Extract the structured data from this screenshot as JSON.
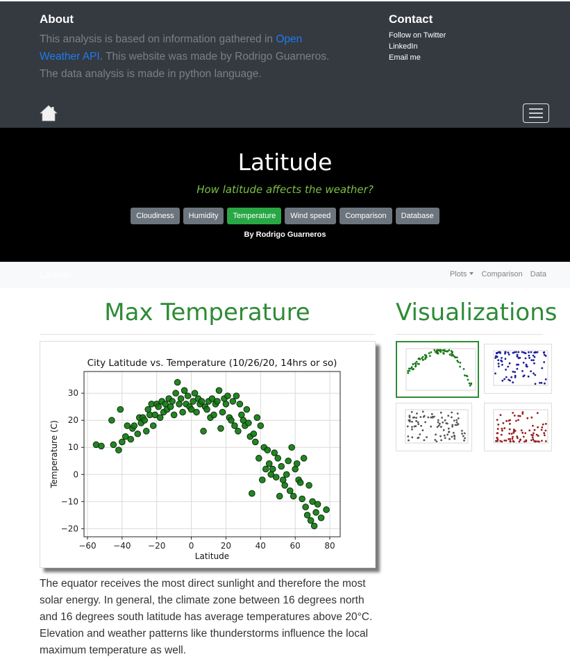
{
  "about": {
    "title": "About",
    "text_before": "This analysis is based on information gathered in ",
    "link": "Open Weather API",
    "text_after": ". This website was made by Rodrigo Guarneros. The data analysis is made in python language."
  },
  "contact": {
    "title": "Contact",
    "links": [
      "Follow on Twitter",
      "LinkedIn",
      "Email me"
    ]
  },
  "hero": {
    "title": "Latitude",
    "subtitle": "How latitude affects the weather?",
    "buttons": [
      "Cloudiness",
      "Humidity",
      "Temperature",
      "Wind speed",
      "Comparison",
      "Database"
    ],
    "active_button": "Temperature",
    "byline": "By Rodrigo Guarneros"
  },
  "navbar": {
    "brand": "Latitude",
    "links": [
      "Plots",
      "Comparison",
      "Data"
    ]
  },
  "main": {
    "heading": "Max Temperature",
    "paragraph": "The equator receives the most direct sunlight and therefore the most solar energy. In general, the climate zone between 16 degrees north and 16 degrees south latitude has average temperatures above 20°C. Elevation and weather patterns like thunderstorms influence the local maximum temperature as well."
  },
  "sidebar": {
    "heading": "Visualizations",
    "thumbnails": [
      {
        "name": "temperature-thumb",
        "color": "#1a7a1a",
        "selected": true
      },
      {
        "name": "humidity-thumb",
        "color": "#1c1c9c",
        "selected": false
      },
      {
        "name": "cloudiness-thumb",
        "color": "#555555",
        "selected": false
      },
      {
        "name": "wind-speed-thumb",
        "color": "#9a1c1c",
        "selected": false
      }
    ]
  },
  "colors": {
    "accent": "#2e8b36",
    "point_fill": "#127a12",
    "footer_bg": "#343a40",
    "link": "#1e7bf0"
  },
  "chart_data": {
    "type": "scatter",
    "title": "City Latitude vs. Temperature (10/26/20, 14hrs or so)",
    "xlabel": "Latitude",
    "ylabel": "Temperature (C)",
    "xlim": [
      -62,
      86
    ],
    "ylim": [
      -23,
      38
    ],
    "xticks": [
      -60,
      -40,
      -20,
      0,
      20,
      40,
      60,
      80
    ],
    "yticks": [
      -20,
      -10,
      0,
      10,
      20,
      30
    ],
    "grid": true,
    "x": [
      -55,
      -52,
      -46,
      -45,
      -42,
      -41,
      -40,
      -38,
      -37,
      -35,
      -34,
      -33,
      -31,
      -30,
      -29,
      -28,
      -27,
      -26,
      -25,
      -24,
      -23,
      -22,
      -21,
      -20,
      -19,
      -18,
      -17,
      -16,
      -15,
      -14,
      -13,
      -12,
      -11,
      -10,
      -9,
      -8,
      -7,
      -6,
      -5,
      -4,
      -3,
      -2,
      -1,
      0,
      1,
      2,
      3,
      4,
      5,
      6,
      7,
      8,
      9,
      10,
      11,
      12,
      13,
      14,
      15,
      16,
      17,
      18,
      19,
      20,
      21,
      22,
      23,
      24,
      25,
      26,
      27,
      28,
      29,
      30,
      31,
      32,
      33,
      34,
      35,
      36,
      37,
      38,
      39,
      40,
      41,
      42,
      43,
      44,
      45,
      46,
      47,
      48,
      49,
      50,
      51,
      52,
      53,
      54,
      55,
      56,
      57,
      58,
      59,
      60,
      61,
      62,
      63,
      64,
      65,
      66,
      67,
      68,
      69,
      70,
      71,
      72,
      73,
      75,
      78
    ],
    "y": [
      11,
      10.5,
      20,
      11,
      9,
      24,
      12,
      14,
      18,
      13,
      17,
      18,
      15,
      21,
      19,
      21,
      20,
      16,
      24,
      22,
      26,
      18,
      22,
      26,
      25,
      21,
      27,
      23,
      26,
      24,
      28,
      25,
      27,
      22,
      30,
      34,
      26,
      28,
      23,
      31,
      26,
      29,
      25,
      24,
      27,
      30,
      23,
      28,
      26,
      27,
      16,
      25,
      24,
      27,
      21,
      28,
      22,
      26,
      27,
      31,
      17,
      23,
      28,
      26,
      29,
      21,
      20,
      27,
      18,
      29,
      16,
      26,
      22,
      20,
      18,
      24,
      19,
      14,
      -7,
      15,
      12,
      21,
      6,
      18,
      -2,
      10,
      2,
      9,
      4,
      0,
      2,
      8,
      -1,
      6,
      -8,
      3,
      -2,
      -4,
      0,
      5,
      -6,
      10,
      -8,
      2,
      4,
      -2,
      -3,
      -9,
      6,
      -12,
      -15,
      -4,
      -17,
      -10,
      -19,
      -14,
      -11,
      -16,
      -13,
      -3
    ],
    "point_color": "#127a12"
  }
}
